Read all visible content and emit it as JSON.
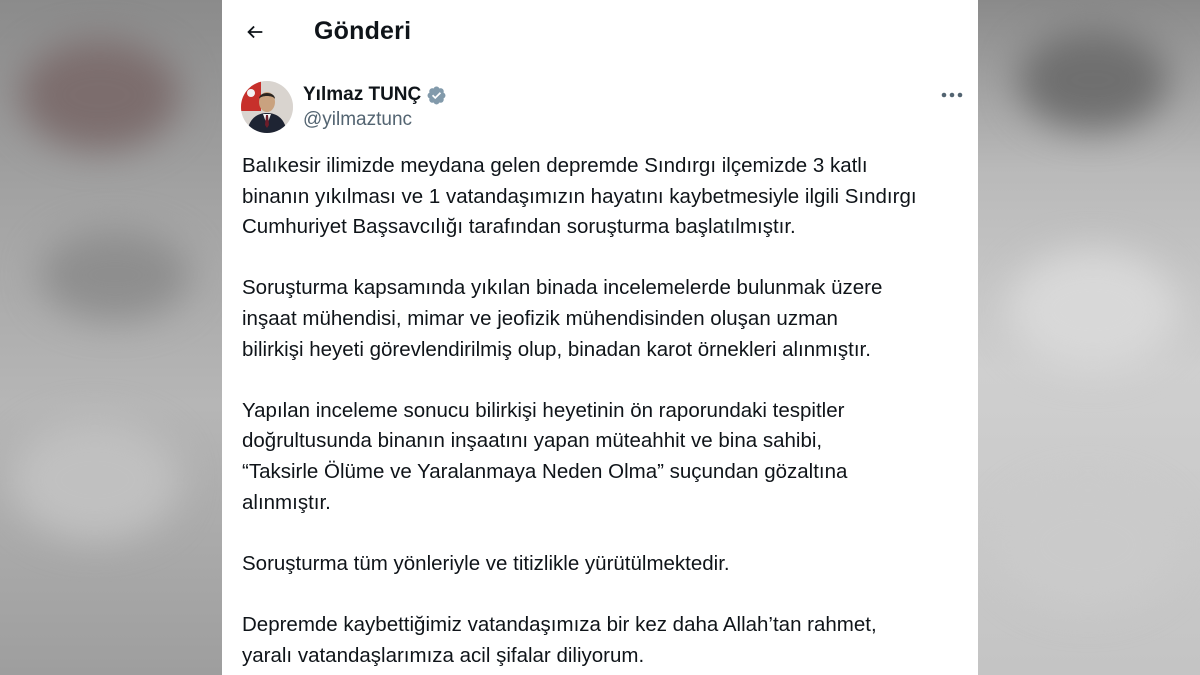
{
  "header": {
    "title": "Gönderi",
    "back_icon": "arrow-left-icon"
  },
  "author": {
    "display_name": "Yılmaz TUNÇ",
    "handle": "@yilmaztunc",
    "verified_icon": "verified-badge-icon",
    "verified_color": "#829aab"
  },
  "post": {
    "paragraphs": [
      "Balıkesir ilimizde meydana gelen depremde Sındırgı ilçemizde 3 katlı\nbinanın yıkılması ve 1 vatandaşımızın hayatını kaybetmesiyle ilgili Sındırgı\nCumhuriyet Başsavcılığı tarafından soruşturma başlatılmıştır.",
      "Soruşturma kapsamında yıkılan binada incelemelerde bulunmak üzere\ninşaat mühendisi, mimar ve jeofizik mühendisinden oluşan uzman\nbilirkişi heyeti görevlendirilmiş olup, binadan karot örnekleri alınmıştır.",
      "Yapılan inceleme sonucu bilirkişi heyetinin ön raporundaki tespitler\ndoğrultusunda binanın inşaatını yapan müteahhit ve bina sahibi,\n“Taksirle Ölüme ve Yaralanmaya Neden Olma” suçundan gözaltına\nalınmıştır.",
      "Soruşturma tüm yönleriyle ve titizlikle yürütülmektedir.",
      "Depremde kaybettiğimiz vatandaşımıza bir kez daha Allah’tan rahmet,\nyaralı vatandaşlarımıza acil şifalar diliyorum."
    ]
  },
  "colors": {
    "text": "#0f1419",
    "secondary_text": "#536471",
    "card_bg": "#ffffff"
  }
}
